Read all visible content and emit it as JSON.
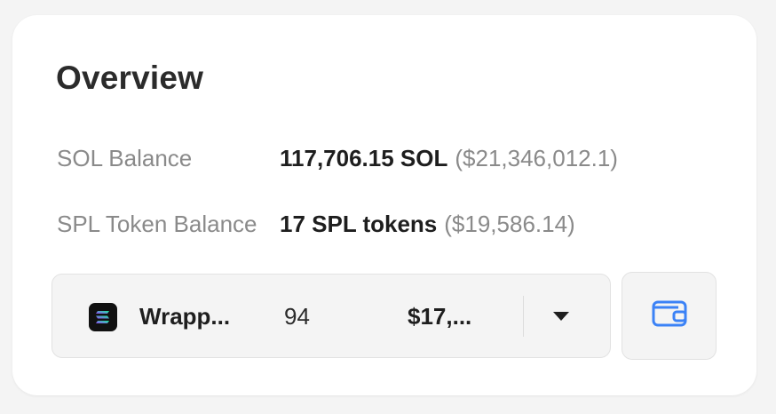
{
  "overview": {
    "title": "Overview",
    "sol_balance": {
      "label": "SOL Balance",
      "value": "117,706.15 SOL",
      "usd": "($21,346,012.1)"
    },
    "spl_balance": {
      "label": "SPL Token Balance",
      "value": "17 SPL tokens",
      "usd": "($19,586.14)"
    }
  },
  "token_selector": {
    "icon": "solana-logo-icon",
    "name": "Wrapp...",
    "amount": "94",
    "usd": "$17,..."
  },
  "wallet_button": {
    "icon": "wallet-icon"
  },
  "colors": {
    "background": "#f4f4f4",
    "card": "#ffffff",
    "accent": "#3b82f6",
    "muted_text": "#8a8a8a",
    "primary_text": "#1e1e1e"
  }
}
